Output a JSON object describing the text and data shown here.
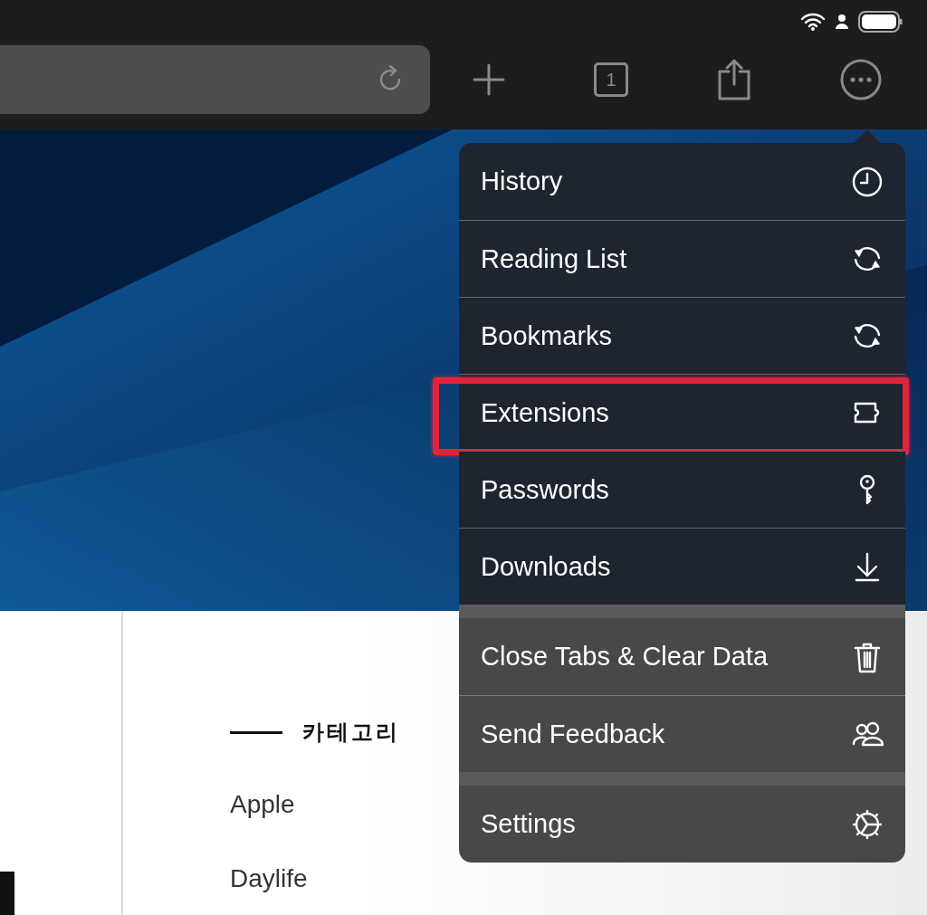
{
  "toolbar": {
    "tab_count": "1"
  },
  "page": {
    "category_heading": "카테고리",
    "categories": [
      "Apple",
      "Daylife"
    ]
  },
  "menu": {
    "sections": [
      {
        "items": [
          {
            "label": "History",
            "highlighted": false
          },
          {
            "label": "Reading List",
            "highlighted": false
          },
          {
            "label": "Bookmarks",
            "highlighted": false
          },
          {
            "label": "Extensions",
            "highlighted": true
          },
          {
            "label": "Passwords",
            "highlighted": false
          },
          {
            "label": "Downloads",
            "highlighted": false
          }
        ]
      },
      {
        "items": [
          {
            "label": "Close Tabs & Clear Data",
            "highlighted": false
          },
          {
            "label": "Send Feedback",
            "highlighted": false
          }
        ]
      },
      {
        "items": [
          {
            "label": "Settings",
            "highlighted": false
          }
        ]
      }
    ]
  }
}
